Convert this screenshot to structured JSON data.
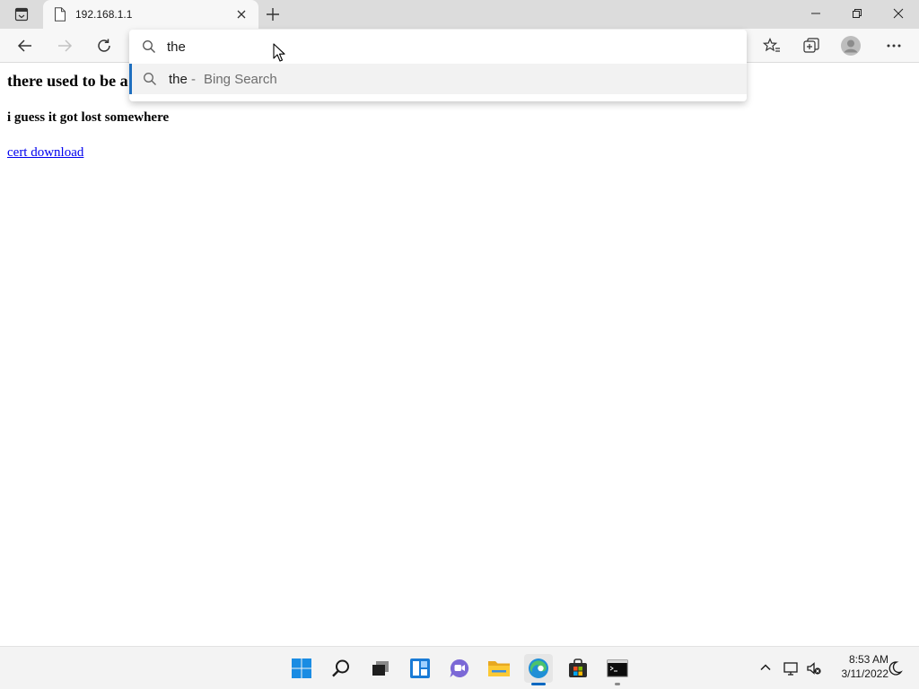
{
  "browser": {
    "tab": {
      "title": "192.168.1.1"
    },
    "omnibox": {
      "query": "the",
      "suggestions": [
        {
          "query": "the",
          "separator": "-",
          "engine": "Bing Search"
        }
      ]
    }
  },
  "page": {
    "heading_main": "there used to be a",
    "heading_sub": "i guess it got lost somewhere",
    "link_text": "cert download"
  },
  "taskbar": {
    "apps": [
      "start",
      "search",
      "task-view",
      "widgets",
      "chat",
      "file-explorer",
      "edge",
      "store",
      "terminal"
    ],
    "clock": {
      "time": "8:53 AM",
      "date": "3/11/2022"
    }
  },
  "colors": {
    "accent": "#0067c0",
    "suggestion_highlight": "#1f6fbf",
    "link": "#0000ee"
  }
}
